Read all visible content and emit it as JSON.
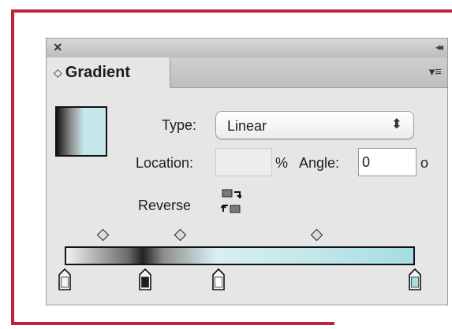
{
  "panel": {
    "tab_label": "Gradient",
    "close_glyph": "×",
    "collapse_glyph": "◂◂",
    "menu_glyph": "▾≡",
    "tab_chevron_glyph": "◇"
  },
  "fields": {
    "type_label": "Type:",
    "type_value": "Linear",
    "location_label": "Location:",
    "location_value": "",
    "percent_unit": "%",
    "angle_label": "Angle:",
    "angle_value": "0",
    "degree_unit": "o",
    "reverse_label": "Reverse"
  },
  "gradient": {
    "stops": [
      {
        "location_pct": 0,
        "color": "#f2f2f2"
      },
      {
        "location_pct": 23,
        "color": "#1e1e1e"
      },
      {
        "location_pct": 44,
        "color": "#ffffff"
      },
      {
        "location_pct": 100,
        "color": "#a5dde1"
      }
    ],
    "midpoints_pct": [
      11,
      33,
      72
    ]
  },
  "colors": {
    "frame_red": "#c41f3b",
    "panel_bg": "#e6e6e6",
    "light_cyan": "#c3e7ea"
  },
  "icons": {
    "close": "close-icon",
    "collapse": "double-chevron-left-icon",
    "panel_menu": "panel-menu-icon",
    "type_select": "up-down-arrows-icon",
    "reverse": "reverse-gradient-icon"
  }
}
